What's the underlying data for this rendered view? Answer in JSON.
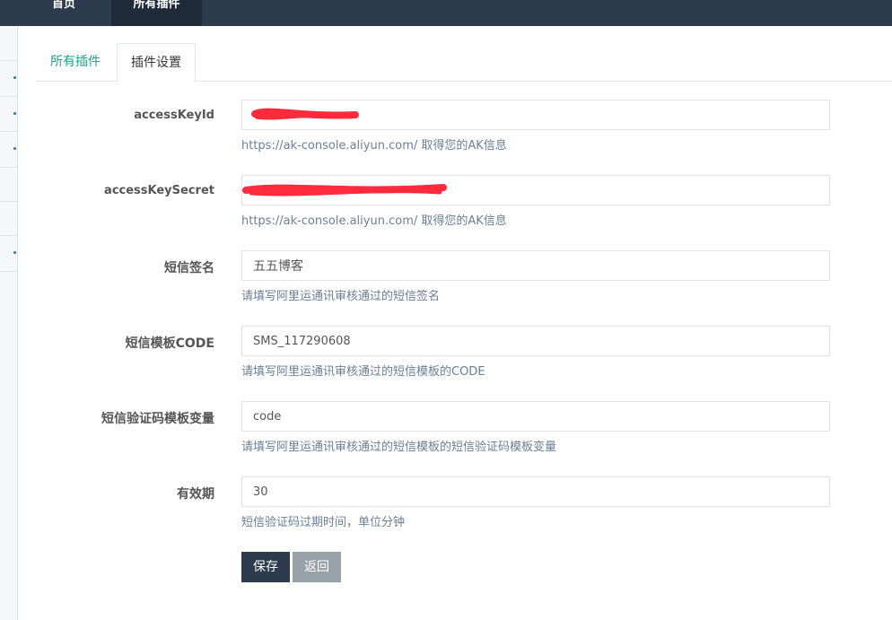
{
  "topnav": {
    "home": "首页",
    "plugins": "所有插件"
  },
  "tabs": {
    "all_plugins": "所有插件",
    "plugin_settings": "插件设置"
  },
  "form": {
    "fields": [
      {
        "label": "accessKeyId",
        "value": "",
        "help": "https://ak-console.aliyun.com/ 取得您的AK信息"
      },
      {
        "label": "accessKeySecret",
        "value": "",
        "help": "https://ak-console.aliyun.com/ 取得您的AK信息"
      },
      {
        "label": "短信签名",
        "value": "五五博客",
        "help": "请填写阿里运通讯审核通过的短信签名"
      },
      {
        "label": "短信模板CODE",
        "value": "SMS_117290608",
        "help": "请填写阿里运通讯审核通过的短信模板的CODE"
      },
      {
        "label": "短信验证码模板变量",
        "value": "code",
        "help": "请填写阿里运通讯审核通过的短信模板的短信验证码模板变量"
      },
      {
        "label": "有效期",
        "value": "30",
        "help": "短信验证码过期时间，单位分钟"
      }
    ]
  },
  "buttons": {
    "save": "保存",
    "back": "返回"
  },
  "colors": {
    "topbar": "#2c3b4d",
    "tab_active_text": "#18a689",
    "help_text": "#6b7f95",
    "save_button": "#2c3b4d",
    "back_button": "#98a1a8",
    "redaction": "#ff2a3c"
  }
}
